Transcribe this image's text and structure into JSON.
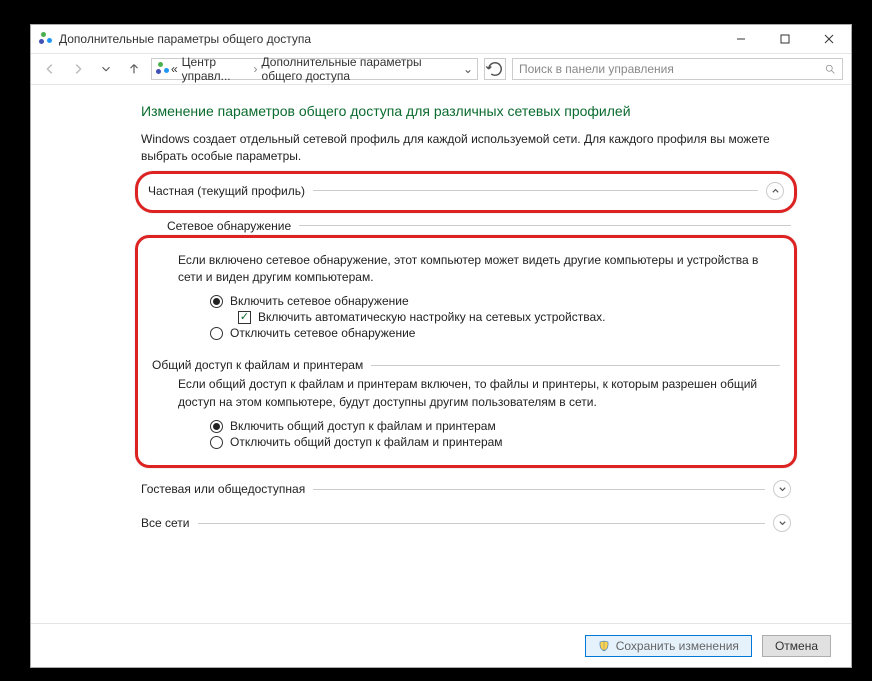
{
  "window": {
    "title": "Дополнительные параметры общего доступа"
  },
  "breadcrumb": {
    "back_prefix": "«",
    "item1": "Центр управл...",
    "item2": "Дополнительные параметры общего доступа"
  },
  "search": {
    "placeholder": "Поиск в панели управления"
  },
  "page": {
    "heading": "Изменение параметров общего доступа для различных сетевых профилей",
    "intro": "Windows создает отдельный сетевой профиль для каждой используемой сети. Для каждого профиля вы можете выбрать особые параметры."
  },
  "profiles": {
    "private": {
      "title": "Частная (текущий профиль)",
      "discovery": {
        "subtitle": "Сетевое обнаружение",
        "desc": "Если включено сетевое обнаружение, этот компьютер может видеть другие компьютеры и устройства в сети и виден другим компьютерам.",
        "opt_on": "Включить сетевое обнаружение",
        "auto": "Включить автоматическую настройку на сетевых устройствах.",
        "opt_off": "Отключить сетевое обнаружение"
      },
      "sharing": {
        "subtitle": "Общий доступ к файлам и принтерам",
        "desc": "Если общий доступ к файлам и принтерам включен, то файлы и принтеры, к которым разрешен общий доступ на этом компьютере, будут доступны другим пользователям в сети.",
        "opt_on": "Включить общий доступ к файлам и принтерам",
        "opt_off": "Отключить общий доступ к файлам и принтерам"
      }
    },
    "guest": {
      "title": "Гостевая или общедоступная"
    },
    "all": {
      "title": "Все сети"
    }
  },
  "footer": {
    "save": "Сохранить изменения",
    "cancel": "Отмена"
  }
}
